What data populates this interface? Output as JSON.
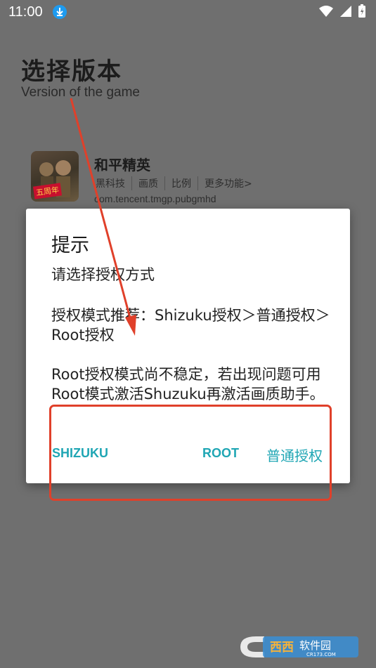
{
  "status_bar": {
    "time": "11:00"
  },
  "header": {
    "title": "选择版本",
    "subtitle": "Version of the game"
  },
  "app": {
    "name": "和平精英",
    "badge": "五周年",
    "tags": [
      "黑科技",
      "画质",
      "比例",
      "更多功能>"
    ],
    "package": "com.tencent.tmgp.pubgmhd"
  },
  "dialog": {
    "title": "提示",
    "line1": "请选择授权方式",
    "line2": "授权模式推荐：Shizuku授权＞普通授权＞Root授权",
    "line3": "Root授权模式尚不稳定，若出现问题可用Root模式激活Shuzuku再激活画质助手。",
    "buttons": {
      "shizuku": "SHIZUKU",
      "root": "ROOT",
      "normal": "普通授权"
    }
  },
  "watermark": {
    "text_main": "西西软件园",
    "text_sub": "CR173.COM"
  },
  "colors": {
    "accent": "#1fa6b4",
    "annotation_red": "#e0402a",
    "scrim": "#6f6f6f"
  }
}
